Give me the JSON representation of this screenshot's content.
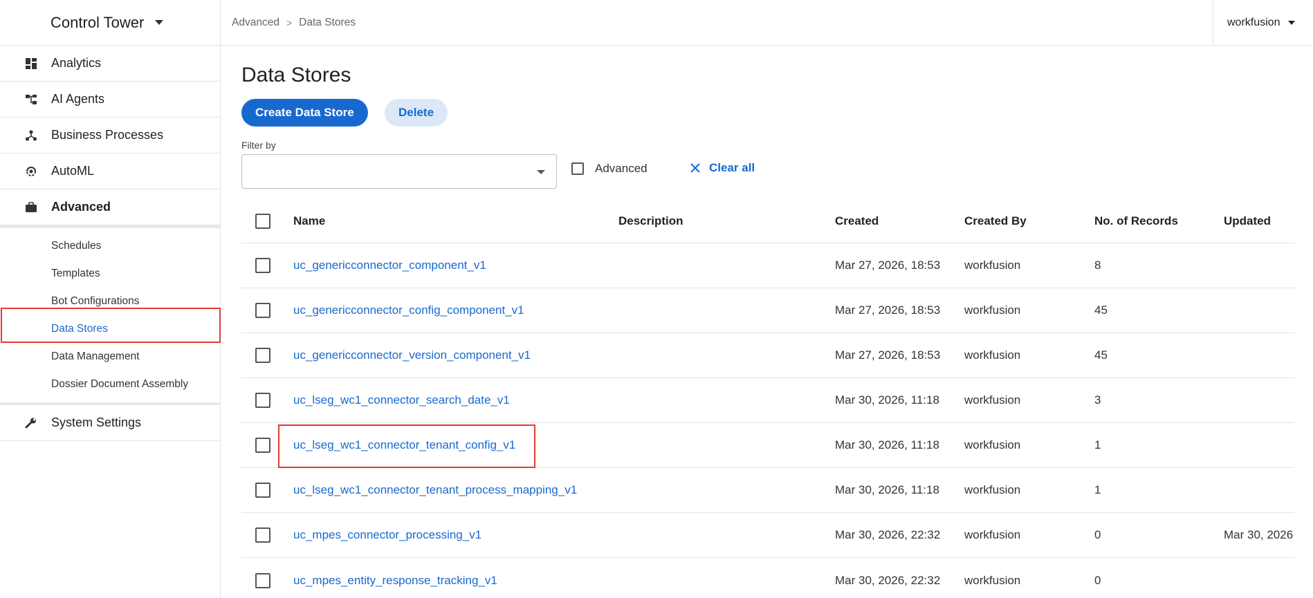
{
  "app": {
    "title": "Control Tower"
  },
  "sidebar": {
    "items": [
      {
        "label": "Analytics",
        "icon": "dashboard-icon"
      },
      {
        "label": "AI Agents",
        "icon": "hierarchy-icon"
      },
      {
        "label": "Business Processes",
        "icon": "process-nodes-icon"
      },
      {
        "label": "AutoML",
        "icon": "brain-icon"
      },
      {
        "label": "Advanced",
        "icon": "briefcase-icon",
        "active": true
      }
    ],
    "sub_items": [
      {
        "label": "Schedules"
      },
      {
        "label": "Templates"
      },
      {
        "label": "Bot Configurations"
      },
      {
        "label": "Data Stores",
        "current": true
      },
      {
        "label": "Data Management"
      },
      {
        "label": "Dossier Document Assembly"
      }
    ],
    "settings": {
      "label": "System Settings",
      "icon": "wrench-icon"
    }
  },
  "breadcrumb": {
    "items": [
      "Advanced",
      "Data Stores"
    ],
    "separator": ">"
  },
  "user": {
    "name": "workfusion"
  },
  "page": {
    "title": "Data Stores",
    "create_button": "Create Data Store",
    "delete_button": "Delete",
    "filter_label": "Filter by",
    "filter_value": "",
    "advanced_label": "Advanced",
    "clear_all_label": "Clear all"
  },
  "table": {
    "columns": [
      "Name",
      "Description",
      "Created",
      "Created By",
      "No. of Records",
      "Updated"
    ],
    "rows": [
      {
        "name": "uc_genericconnector_component_v1",
        "description": "",
        "created": "Mar 27, 2026, 18:53",
        "created_by": "workfusion",
        "records": "8",
        "updated": ""
      },
      {
        "name": "uc_genericconnector_config_component_v1",
        "description": "",
        "created": "Mar 27, 2026, 18:53",
        "created_by": "workfusion",
        "records": "45",
        "updated": ""
      },
      {
        "name": "uc_genericconnector_version_component_v1",
        "description": "",
        "created": "Mar 27, 2026, 18:53",
        "created_by": "workfusion",
        "records": "45",
        "updated": ""
      },
      {
        "name": "uc_lseg_wc1_connector_search_date_v1",
        "description": "",
        "created": "Mar 30, 2026, 11:18",
        "created_by": "workfusion",
        "records": "3",
        "updated": ""
      },
      {
        "name": "uc_lseg_wc1_connector_tenant_config_v1",
        "description": "",
        "created": "Mar 30, 2026, 11:18",
        "created_by": "workfusion",
        "records": "1",
        "updated": ""
      },
      {
        "name": "uc_lseg_wc1_connector_tenant_process_mapping_v1",
        "description": "",
        "created": "Mar 30, 2026, 11:18",
        "created_by": "workfusion",
        "records": "1",
        "updated": ""
      },
      {
        "name": "uc_mpes_connector_processing_v1",
        "description": "",
        "created": "Mar 30, 2026, 22:32",
        "created_by": "workfusion",
        "records": "0",
        "updated": "Mar 30, 2026"
      },
      {
        "name": "uc_mpes_entity_response_tracking_v1",
        "description": "",
        "created": "Mar 30, 2026, 22:32",
        "created_by": "workfusion",
        "records": "0",
        "updated": ""
      }
    ]
  },
  "colors": {
    "accent": "#1769d0",
    "highlight": "#e53935"
  }
}
